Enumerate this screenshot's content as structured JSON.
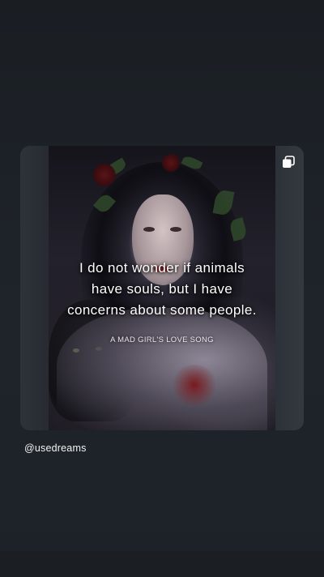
{
  "post": {
    "quote_lines": [
      "I do not wonder if animals",
      "have souls, but I have",
      "concerns about some people."
    ],
    "caption": "A MAD GIRL'S LOVE SONG",
    "multi_icon": "multiple-images-icon"
  },
  "author": {
    "handle": "@usedreams"
  },
  "colors": {
    "background": "#1c2026",
    "card": "#2b2f36",
    "text": "#ffffff"
  }
}
